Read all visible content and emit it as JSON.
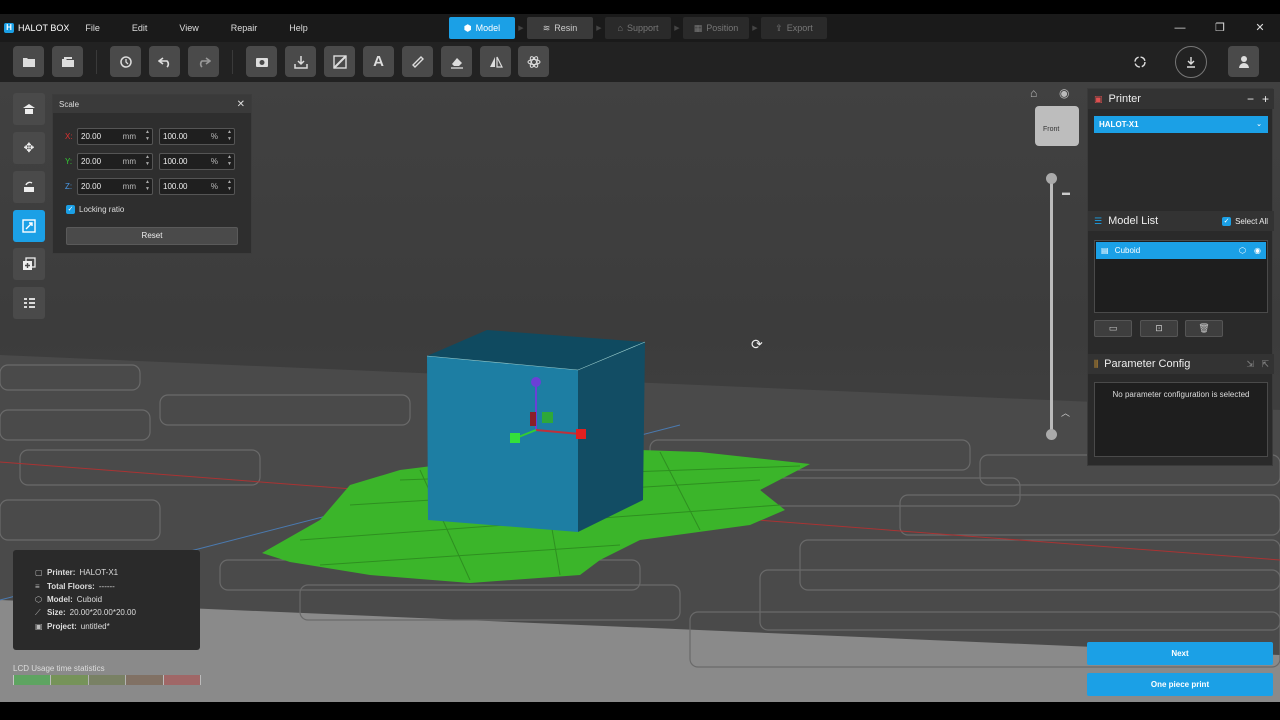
{
  "app": {
    "name": "HALOT BOX",
    "logo_letter": "H",
    "menu": [
      "File",
      "Edit",
      "View",
      "Repair",
      "Help"
    ]
  },
  "steps": [
    {
      "label": "Model",
      "state": "active"
    },
    {
      "label": "Resin",
      "state": "enabled"
    },
    {
      "label": "Support",
      "state": "disabled"
    },
    {
      "label": "Position",
      "state": "disabled"
    },
    {
      "label": "Export",
      "state": "disabled"
    }
  ],
  "window_controls": {
    "minimize": "—",
    "restore": "❐",
    "close": "✕"
  },
  "scale_panel": {
    "title": "Scale",
    "x": {
      "label": "X:",
      "value": "20.00",
      "unit": "mm",
      "percent": "100.00",
      "percent_unit": "%"
    },
    "y": {
      "label": "Y:",
      "value": "20.00",
      "unit": "mm",
      "percent": "100.00",
      "percent_unit": "%"
    },
    "z": {
      "label": "Z:",
      "value": "20.00",
      "unit": "mm",
      "percent": "100.00",
      "percent_unit": "%"
    },
    "locking_ratio": "Locking ratio",
    "reset": "Reset"
  },
  "view_cube": {
    "label": "Front"
  },
  "printer_panel": {
    "title": "Printer",
    "selected": "HALOT-X1"
  },
  "model_list": {
    "title": "Model List",
    "select_all": "Select All",
    "items": [
      "Cuboid"
    ]
  },
  "parameter_config": {
    "title": "Parameter Config",
    "empty": "No parameter configuration is selected"
  },
  "info": {
    "printer_label": "Printer:",
    "printer": "HALOT-X1",
    "floors_label": "Total Floors:",
    "floors": "------",
    "model_label": "Model:",
    "model": "Cuboid",
    "size_label": "Size:",
    "size": "20.00*20.00*20.00",
    "project_label": "Project:",
    "project": "untitled*"
  },
  "lcd_stats": {
    "label": "LCD Usage time statistics",
    "colors": [
      "#4caf50",
      "#8bc34a",
      "#cddc39",
      "#ff9800",
      "#f44336"
    ]
  },
  "actions": {
    "next": "Next",
    "one_piece_print": "One piece print"
  },
  "colors": {
    "accent": "#1ba0e6",
    "plate_green": "#3bb52a",
    "cube_front": "#1d7ea3"
  }
}
